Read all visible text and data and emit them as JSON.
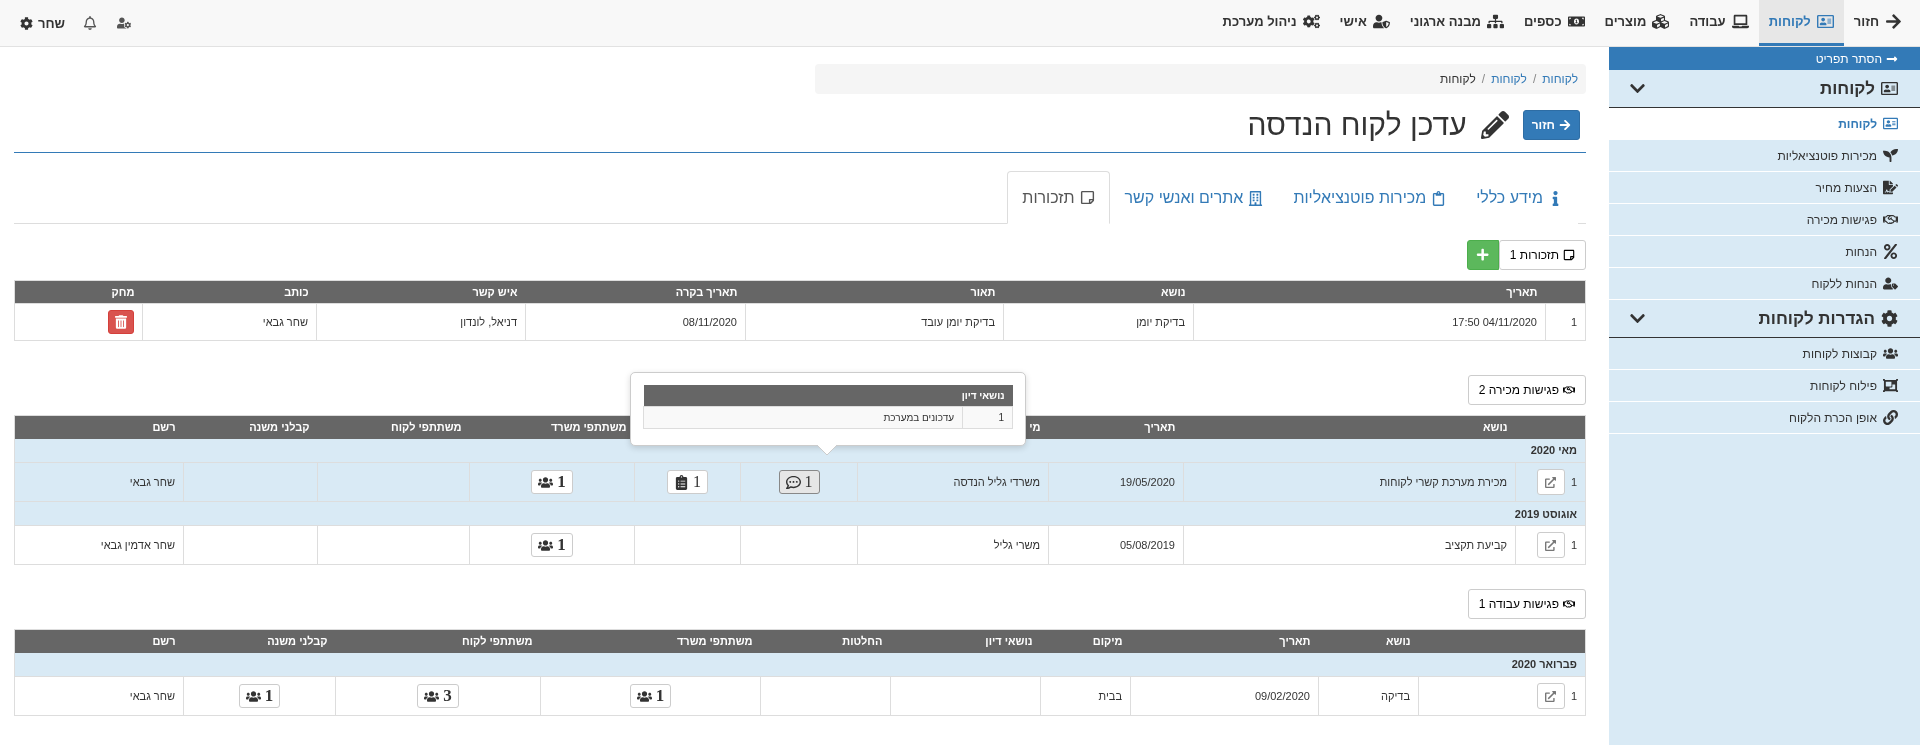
{
  "top_nav": {
    "items": [
      {
        "label": "חזור",
        "selected": false
      },
      {
        "label": "לקוחות",
        "selected": true
      },
      {
        "label": "עבודה",
        "selected": false
      },
      {
        "label": "מוצרים",
        "selected": false
      },
      {
        "label": "כספים",
        "selected": false
      },
      {
        "label": "מבנה ארגוני",
        "selected": false
      },
      {
        "label": "אישי",
        "selected": false
      },
      {
        "label": "ניהול מערכת",
        "selected": false
      }
    ],
    "user_name": "שחר"
  },
  "sidebar": {
    "hide_label": "הסתר תפריט",
    "sections": [
      {
        "title": "לקוחות",
        "expanded": true,
        "items": [
          {
            "label": "לקוחות",
            "selected": true
          },
          {
            "label": "מכירות פוטנציאליות",
            "selected": false
          },
          {
            "label": "הצעות מחיר",
            "selected": false
          },
          {
            "label": "פגישות מכירה",
            "selected": false
          },
          {
            "label": "הנחות",
            "selected": false
          },
          {
            "label": "הנחות ללקוח",
            "selected": false
          }
        ]
      },
      {
        "title": "הגדרות לקוחות",
        "expanded": true,
        "items": [
          {
            "label": "קבוצות לקוחות",
            "selected": false
          },
          {
            "label": "פילוח לקוחות",
            "selected": false
          },
          {
            "label": "אופן הכרת הלקוח",
            "selected": false
          }
        ]
      }
    ]
  },
  "breadcrumb": [
    {
      "label": "לקוחות",
      "active": false
    },
    {
      "separator": "/",
      "label": "לקוחות",
      "active": false
    },
    {
      "separator": "/",
      "label": "לקוחות",
      "active": true
    }
  ],
  "page": {
    "back_button": "חזור",
    "title": "עדכן לקוח הנדסה"
  },
  "tabs": [
    {
      "label": "מידע כללי",
      "selected": false
    },
    {
      "label": "מכירות פוטנציאליות",
      "selected": false
    },
    {
      "label": "אתרים ואנשי קשר",
      "selected": false
    },
    {
      "label": "תזכורות",
      "selected": true
    }
  ],
  "reminders": {
    "button": "תזכורות 1",
    "columns": [
      "תאריך",
      "נושא",
      "תאור",
      "תאריך בקרה",
      "איש קשר",
      "כותב",
      "מחק"
    ],
    "rows": [
      {
        "index": "1",
        "cells": [
          "04/11/2020 17:50",
          "בדיקת יומן",
          "בדיקת יומן עובד",
          "08/11/2020",
          "דניאל, לונדון",
          "שחר גבאי"
        ]
      }
    ]
  },
  "sales_meetings": {
    "button": "פגישות מכירה 2",
    "columns": [
      "נושא",
      "תאריך",
      "מי",
      "משתתפי משרד",
      "משתתפי לקוח",
      "קבלני משנה",
      "רשם"
    ],
    "groups": [
      {
        "month": "מאי 2020",
        "rows": [
          {
            "index": "1",
            "subject": "מכירת מערכת קשרי לקוחות",
            "date": "19/05/2020",
            "location": "משרדי גליל הנדסה",
            "topics": "1",
            "decisions": "1",
            "office": "1",
            "recorder": "שחר גבאי"
          }
        ]
      },
      {
        "month": "אוגוסט 2019",
        "rows": [
          {
            "index": "1",
            "subject": "קביעת תקציב",
            "date": "05/08/2019",
            "location": "משרי גליל",
            "office": "1",
            "recorder": "שחר אדמין גבאי"
          }
        ]
      }
    ],
    "popover": {
      "heading": "נושאי דיון",
      "rows": [
        {
          "index": "1",
          "text": "עדכונים במערכת"
        }
      ]
    }
  },
  "work_meetings": {
    "button": "פגישות עבודה 1",
    "columns": [
      "נושא",
      "תאריך",
      "מיקום",
      "נושאי דיון",
      "החלטות",
      "משתתפי משרד",
      "משתתפי לקוח",
      "קבלני משנה",
      "רשם"
    ],
    "groups": [
      {
        "month": "פברואר 2020",
        "rows": [
          {
            "index": "1",
            "subject": "בדיקה",
            "date": "09/02/2020",
            "location": "בבית",
            "office": "1",
            "client": "3",
            "subcontractors": "1",
            "recorder": "שחר גבאי"
          }
        ]
      }
    ]
  }
}
